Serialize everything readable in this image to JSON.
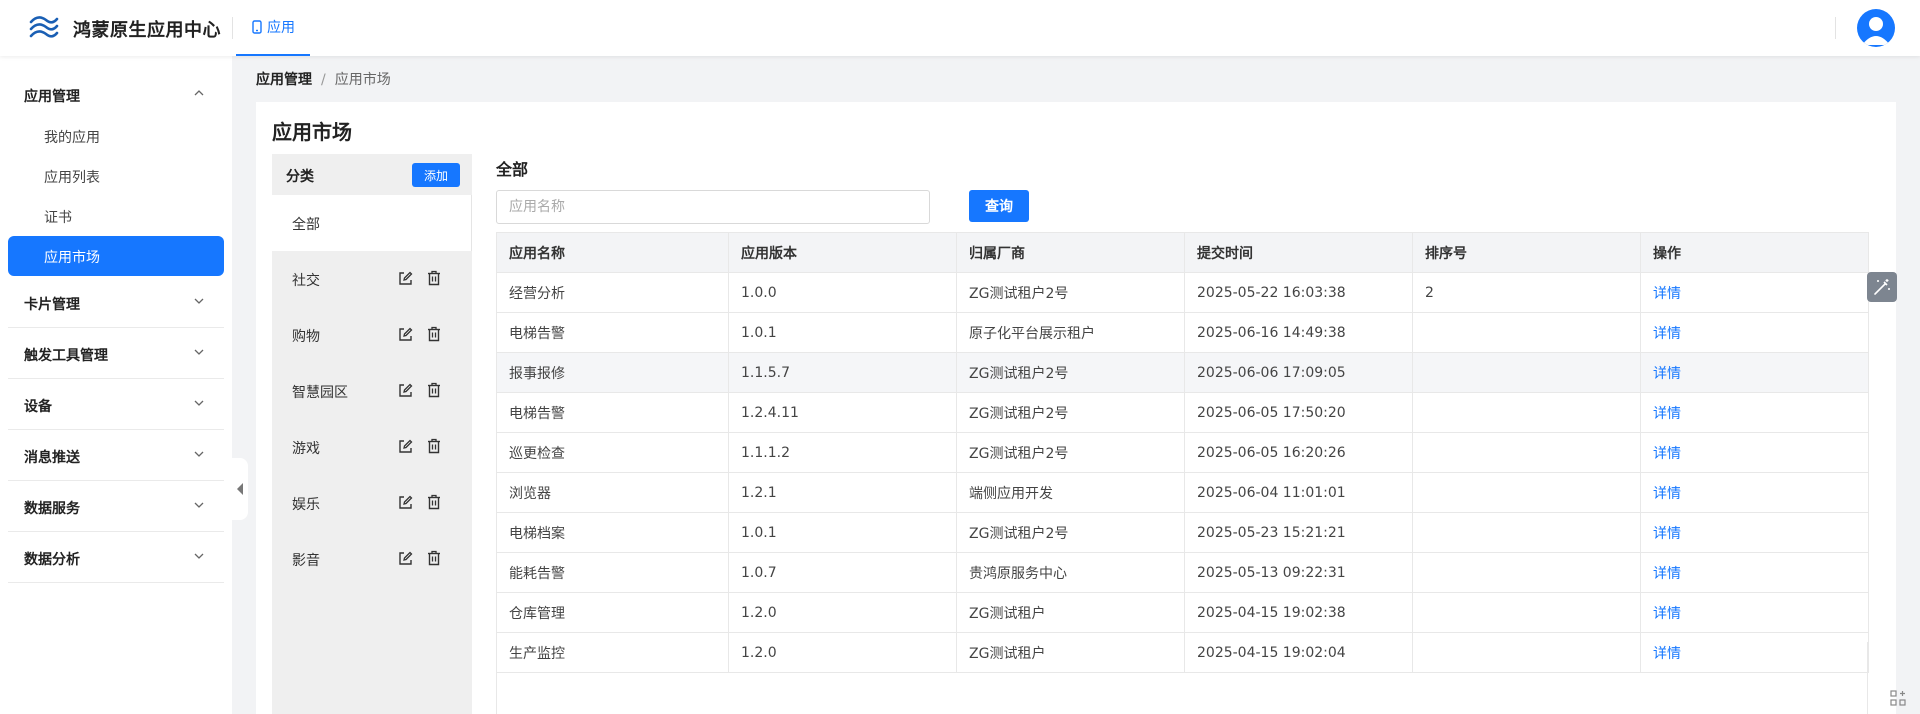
{
  "header": {
    "brand": "鸿蒙原生应用中心",
    "tab_label": "应用"
  },
  "sidebar": {
    "group_app": "应用管理",
    "sub_items": [
      {
        "label": "我的应用"
      },
      {
        "label": "应用列表"
      },
      {
        "label": "证书"
      },
      {
        "label": "应用市场"
      }
    ],
    "groups": [
      {
        "label": "卡片管理"
      },
      {
        "label": "触发工具管理"
      },
      {
        "label": "设备"
      },
      {
        "label": "消息推送"
      },
      {
        "label": "数据服务"
      },
      {
        "label": "数据分析"
      }
    ]
  },
  "breadcrumb": {
    "parent": "应用管理",
    "separator": "/",
    "current": "应用市场"
  },
  "page": {
    "title": "应用市场",
    "all_label": "全部"
  },
  "categories": {
    "title": "分类",
    "add_label": "添加",
    "items": [
      {
        "label": "全部"
      },
      {
        "label": "社交"
      },
      {
        "label": "购物"
      },
      {
        "label": "智慧园区"
      },
      {
        "label": "游戏"
      },
      {
        "label": "娱乐"
      },
      {
        "label": "影音"
      }
    ]
  },
  "search": {
    "placeholder": "应用名称",
    "value": "",
    "button_label": "查询"
  },
  "table": {
    "headers": [
      "应用名称",
      "应用版本",
      "归属厂商",
      "提交时间",
      "排序号",
      "操作"
    ],
    "rows": [
      {
        "name": "经营分析",
        "version": "1.0.0",
        "vendor": "ZG测试租户2号",
        "time": "2025-05-22 16:03:38",
        "order": "2",
        "action": "详情"
      },
      {
        "name": "电梯告警",
        "version": "1.0.1",
        "vendor": "原子化平台展示租户",
        "time": "2025-06-16 14:49:38",
        "order": "",
        "action": "详情"
      },
      {
        "name": "报事报修",
        "version": "1.1.5.7",
        "vendor": "ZG测试租户2号",
        "time": "2025-06-06 17:09:05",
        "order": "",
        "action": "详情"
      },
      {
        "name": "电梯告警",
        "version": "1.2.4.11",
        "vendor": "ZG测试租户2号",
        "time": "2025-06-05 17:50:20",
        "order": "",
        "action": "详情"
      },
      {
        "name": "巡更检查",
        "version": "1.1.1.2",
        "vendor": "ZG测试租户2号",
        "time": "2025-06-05 16:20:26",
        "order": "",
        "action": "详情"
      },
      {
        "name": "浏览器",
        "version": "1.2.1",
        "vendor": "端侧应用开发",
        "time": "2025-06-04 11:01:01",
        "order": "",
        "action": "详情"
      },
      {
        "name": "电梯档案",
        "version": "1.0.1",
        "vendor": "ZG测试租户2号",
        "time": "2025-05-23 15:21:21",
        "order": "",
        "action": "详情"
      },
      {
        "name": "能耗告警",
        "version": "1.0.7",
        "vendor": "贵鸿原服务中心",
        "time": "2025-05-13 09:22:31",
        "order": "",
        "action": "详情"
      },
      {
        "name": "仓库管理",
        "version": "1.2.0",
        "vendor": "ZG测试租户",
        "time": "2025-04-15 19:02:38",
        "order": "",
        "action": "详情"
      },
      {
        "name": "生产监控",
        "version": "1.2.0",
        "vendor": "ZG测试租户",
        "time": "2025-04-15 19:02:04",
        "order": "",
        "action": "详情"
      }
    ]
  },
  "colors": {
    "accent": "#1677ff",
    "sidebar_bg": "#ffffff",
    "category_bg": "#efefef",
    "page_bg": "#f2f3f5"
  },
  "icons": {
    "logo": "harmony-logo-icon",
    "tab": "phone-icon",
    "avatar": "user-avatar-icon",
    "edit": "edit-icon",
    "delete": "trash-icon",
    "tool": "magic-wand-icon"
  }
}
